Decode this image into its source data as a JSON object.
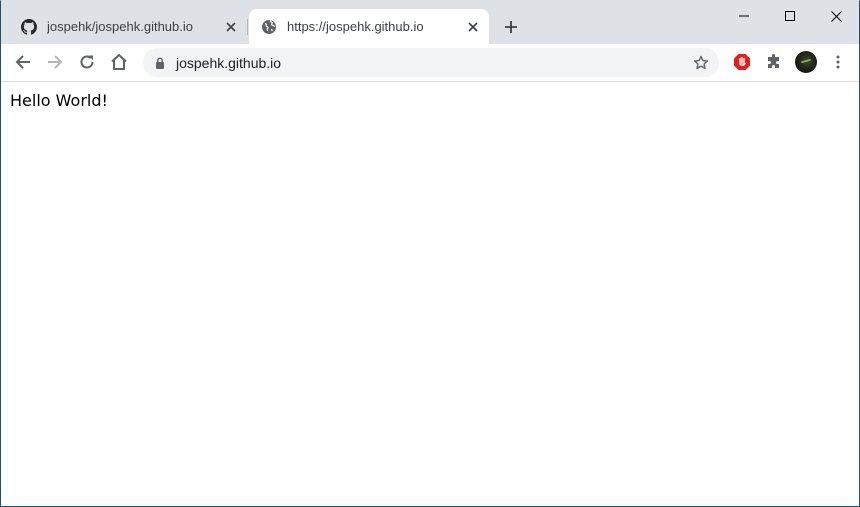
{
  "tabs": [
    {
      "title": "jospehk/jospehk.github.io",
      "favicon": "github-icon",
      "active": false
    },
    {
      "title": "https://jospehk.github.io",
      "favicon": "globe-icon",
      "active": true
    }
  ],
  "toolbar": {
    "url": "jospehk.github.io"
  },
  "page": {
    "text": "Hello World!"
  }
}
